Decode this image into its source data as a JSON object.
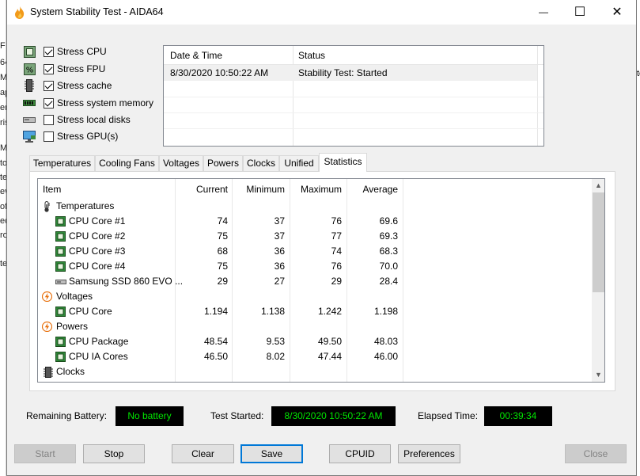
{
  "window": {
    "title": "System Stability Test - AIDA64",
    "minimize_glyph": "—",
    "maximize_glyph": "☐",
    "close_glyph": "✕"
  },
  "background_app": {
    "left_chars": [
      "F",
      "64",
      "Mo",
      "ap",
      "er",
      "ris",
      "Mu",
      "to",
      "te",
      "ev",
      "of",
      "ed",
      "ro",
      "ter"
    ],
    "right_char": "te"
  },
  "stress_options": [
    {
      "label": "Stress CPU",
      "checked": true,
      "icon": "cpu-chip-icon"
    },
    {
      "label": "Stress FPU",
      "checked": true,
      "icon": "fpu-percent-icon"
    },
    {
      "label": "Stress cache",
      "checked": true,
      "icon": "cache-chip-icon"
    },
    {
      "label": "Stress system memory",
      "checked": true,
      "icon": "memory-module-icon"
    },
    {
      "label": "Stress local disks",
      "checked": false,
      "icon": "disk-drive-icon"
    },
    {
      "label": "Stress GPU(s)",
      "checked": false,
      "icon": "monitor-gpu-icon"
    }
  ],
  "log": {
    "headers": [
      "Date & Time",
      "Status"
    ],
    "rows": [
      {
        "datetime": "8/30/2020 10:50:22 AM",
        "status": "Stability Test: Started"
      }
    ]
  },
  "tabs": [
    "Temperatures",
    "Cooling Fans",
    "Voltages",
    "Powers",
    "Clocks",
    "Unified",
    "Statistics"
  ],
  "active_tab": "Statistics",
  "stats": {
    "headers": {
      "item": "Item",
      "current": "Current",
      "minimum": "Minimum",
      "maximum": "Maximum",
      "average": "Average"
    },
    "rows": [
      {
        "type": "group",
        "label": "Temperatures",
        "icon": "thermometer-icon"
      },
      {
        "type": "item",
        "label": "CPU Core #1",
        "icon": "cpu-chip-icon",
        "current": "74",
        "minimum": "37",
        "maximum": "76",
        "average": "69.6"
      },
      {
        "type": "item",
        "label": "CPU Core #2",
        "icon": "cpu-chip-icon",
        "current": "75",
        "minimum": "37",
        "maximum": "77",
        "average": "69.3"
      },
      {
        "type": "item",
        "label": "CPU Core #3",
        "icon": "cpu-chip-icon",
        "current": "68",
        "minimum": "36",
        "maximum": "74",
        "average": "68.3"
      },
      {
        "type": "item",
        "label": "CPU Core #4",
        "icon": "cpu-chip-icon",
        "current": "75",
        "minimum": "36",
        "maximum": "76",
        "average": "70.0"
      },
      {
        "type": "item",
        "label": "Samsung SSD 860 EVO ...",
        "icon": "ssd-drive-icon",
        "current": "29",
        "minimum": "27",
        "maximum": "29",
        "average": "28.4"
      },
      {
        "type": "group",
        "label": "Voltages",
        "icon": "lightning-icon"
      },
      {
        "type": "item",
        "label": "CPU Core",
        "icon": "cpu-chip-icon",
        "current": "1.194",
        "minimum": "1.138",
        "maximum": "1.242",
        "average": "1.198"
      },
      {
        "type": "group",
        "label": "Powers",
        "icon": "lightning-icon"
      },
      {
        "type": "item",
        "label": "CPU Package",
        "icon": "cpu-chip-icon",
        "current": "48.54",
        "minimum": "9.53",
        "maximum": "49.50",
        "average": "48.03"
      },
      {
        "type": "item",
        "label": "CPU IA Cores",
        "icon": "cpu-chip-icon",
        "current": "46.50",
        "minimum": "8.02",
        "maximum": "47.44",
        "average": "46.00"
      },
      {
        "type": "group",
        "label": "Clocks",
        "icon": "clock-chip-icon"
      }
    ]
  },
  "status": {
    "battery_label": "Remaining Battery:",
    "battery_value": "No battery",
    "started_label": "Test Started:",
    "started_value": "8/30/2020 10:50:22 AM",
    "elapsed_label": "Elapsed Time:",
    "elapsed_value": "00:39:34"
  },
  "buttons": {
    "start": "Start",
    "stop": "Stop",
    "clear": "Clear",
    "save": "Save",
    "cpuid": "CPUID",
    "preferences": "Preferences",
    "close": "Close"
  },
  "colors": {
    "status_text": "#00e600",
    "status_bg": "#000000",
    "chip_green": "#2f8a3a",
    "lightning": "#e8700c"
  }
}
